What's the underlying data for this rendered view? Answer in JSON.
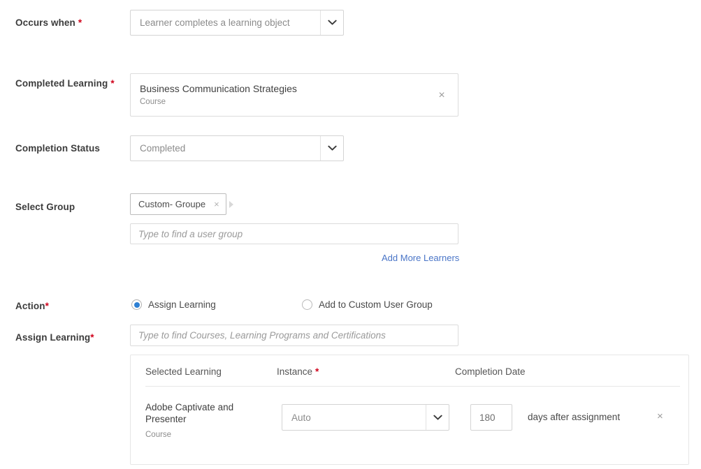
{
  "fields": {
    "occurs_when": {
      "label": "Occurs when",
      "required": true,
      "value": "Learner completes a learning object"
    },
    "completed_learning": {
      "label": "Completed Learning",
      "required": true,
      "title": "Business Communication Strategies",
      "subtitle": "Course",
      "remove_icon": "×"
    },
    "completion_status": {
      "label": "Completion Status",
      "required": false,
      "value": "Completed"
    },
    "select_group": {
      "label": "Select Group",
      "required": false,
      "chip": {
        "text": "Custom- Groupe",
        "remove_icon": "×"
      },
      "search_placeholder": "Type to find a user group",
      "add_more_link": "Add More Learners"
    },
    "action": {
      "label": "Action",
      "required": true,
      "options": [
        {
          "label": "Assign Learning",
          "selected": true
        },
        {
          "label": "Add to Custom User Group",
          "selected": false
        }
      ]
    },
    "assign_learning": {
      "label": "Assign Learning",
      "required": true,
      "search_placeholder": "Type to find Courses, Learning Programs and Certifications"
    }
  },
  "table": {
    "headers": {
      "selected_learning": "Selected Learning",
      "instance": "Instance",
      "instance_required": true,
      "completion_date": "Completion Date"
    },
    "rows": [
      {
        "name": "Adobe Captivate and Presenter",
        "type": "Course",
        "instance": "Auto",
        "days": "180",
        "days_suffix": "days after assignment",
        "remove_icon": "×"
      }
    ]
  },
  "colors": {
    "required_asterisk": "#d0021b",
    "link": "#4a75c7",
    "radio_selected": "#2d7fd3",
    "border": "#dcdcdc",
    "placeholder": "#9a9a9a"
  }
}
